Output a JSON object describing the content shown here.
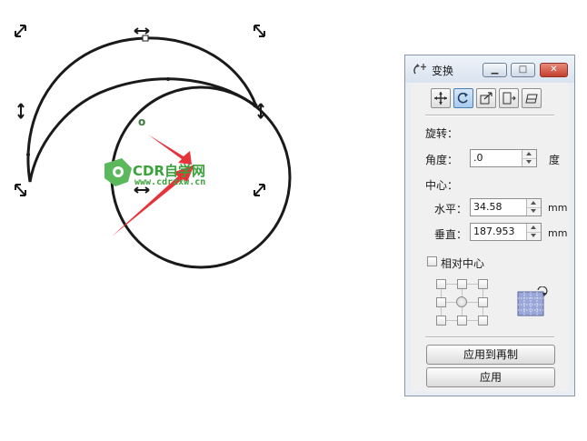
{
  "watermark": {
    "title": "CDR自学网",
    "url": "www.cdrzxw.cn"
  },
  "canvas": {
    "origin_marker": "o"
  },
  "docker": {
    "title": "变换",
    "icons": [
      "position-icon",
      "rotate-icon",
      "scale-icon",
      "size-icon",
      "skew-icon"
    ],
    "rotate_label": "旋转：",
    "angle": {
      "label": "角度：",
      "value": ".0",
      "unit": "度"
    },
    "center_label": "中心：",
    "horizontal": {
      "label": "水平：",
      "value": "34.58",
      "unit": "mm"
    },
    "vertical": {
      "label": "垂直：",
      "value": "187.953",
      "unit": "mm"
    },
    "relative_center": {
      "label": "相对中心",
      "checked": false
    },
    "apply_copy_label": "应用到再制",
    "apply_label": "应用"
  },
  "colors": {
    "accent": "#4a7fb5",
    "arrow": "#e8323a",
    "watermark": "#3aa23a"
  }
}
